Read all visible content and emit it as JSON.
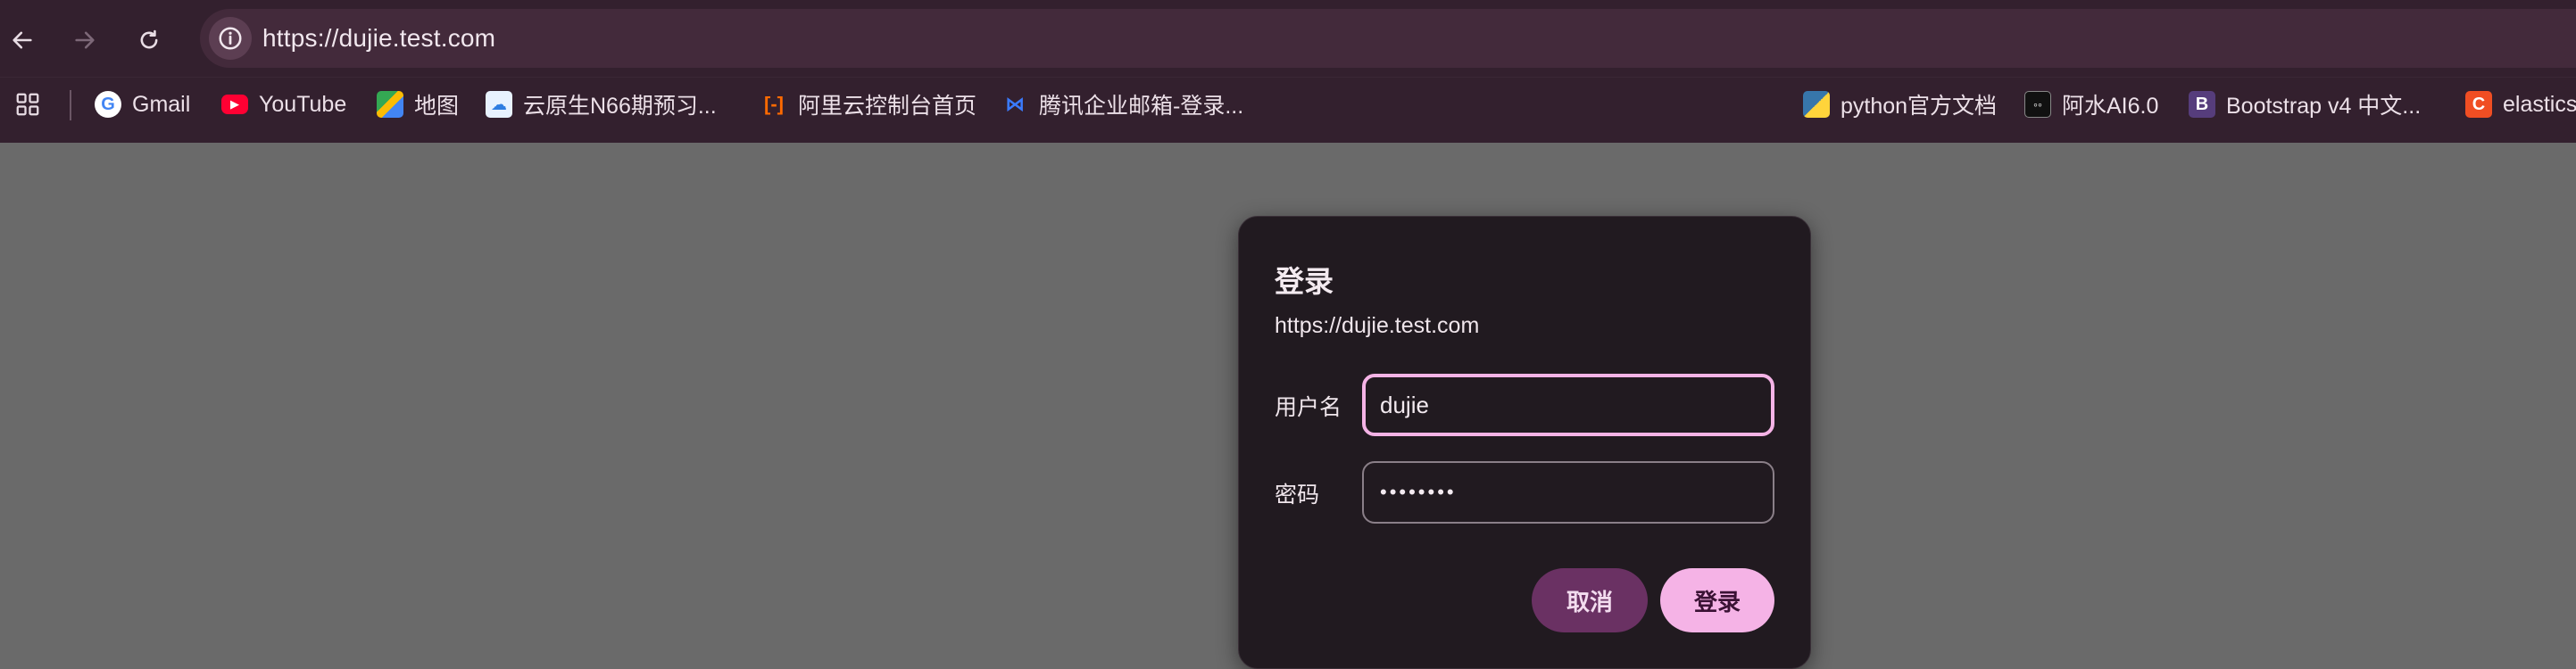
{
  "browser": {
    "url": "https://dujie.test.com",
    "icons": {
      "back": "back-arrow-icon",
      "forward": "forward-arrow-icon",
      "reload": "reload-icon",
      "site_info": "info-icon",
      "apps": "apps-grid-icon"
    }
  },
  "bookmarks": [
    {
      "label": "Gmail",
      "icon": "google-icon"
    },
    {
      "label": "YouTube",
      "icon": "youtube-icon"
    },
    {
      "label": "地图",
      "icon": "maps-icon"
    },
    {
      "label": "云原生N66期预习...",
      "icon": "cloud-icon"
    },
    {
      "label": "阿里云控制台首页",
      "icon": "aliyun-icon"
    },
    {
      "label": "腾讯企业邮箱-登录...",
      "icon": "tencent-mail-icon"
    },
    {
      "label": "python官方文档",
      "icon": "python-icon"
    },
    {
      "label": "阿水AI6.0",
      "icon": "ai-icon"
    },
    {
      "label": "Bootstrap v4 中文...",
      "icon": "bootstrap-icon"
    },
    {
      "label": "elastics",
      "icon": "elastic-icon"
    }
  ],
  "dialog": {
    "title": "登录",
    "origin": "https://dujie.test.com",
    "username_label": "用户名",
    "username_value": "dujie",
    "password_label": "密码",
    "password_value": "••••••••",
    "cancel_label": "取消",
    "submit_label": "登录"
  },
  "colors": {
    "toolbar_bg": "#33202e",
    "accent": "#f5b3e6",
    "cancel_bg": "#6a3163",
    "page_bg": "#6a6a6a"
  }
}
